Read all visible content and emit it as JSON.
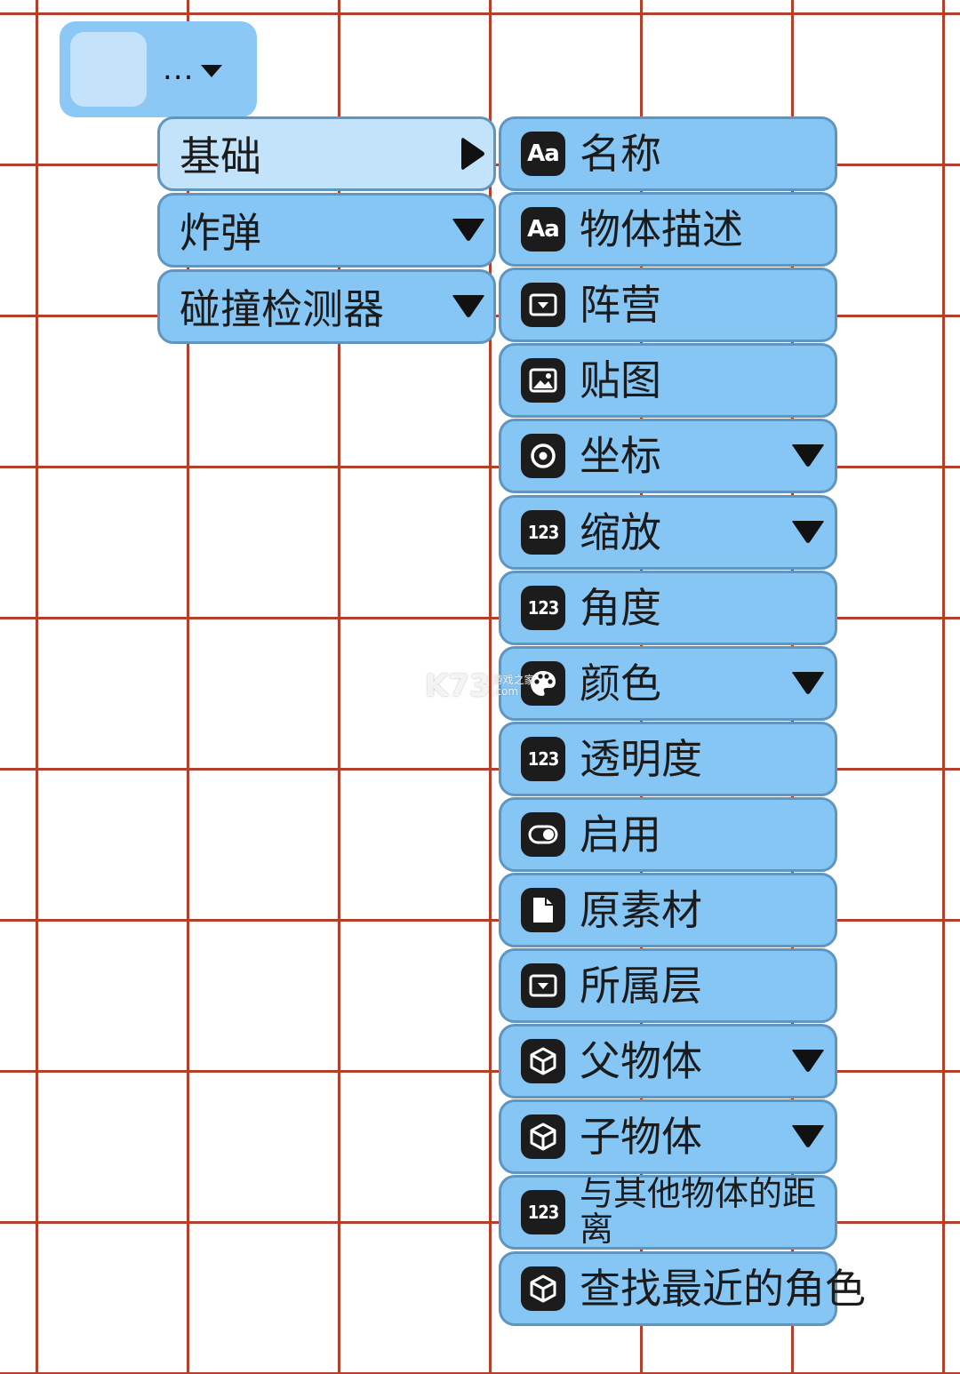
{
  "trigger": {
    "dots": "..."
  },
  "categories": [
    {
      "label": "基础",
      "arrow": "right",
      "selected": true
    },
    {
      "label": "炸弹",
      "arrow": "down",
      "selected": false
    },
    {
      "label": "碰撞检测器",
      "arrow": "down",
      "selected": false
    }
  ],
  "properties": [
    {
      "label": "名称",
      "icon": "text-icon",
      "icon_text": "Aa",
      "arrow": "none"
    },
    {
      "label": "物体描述",
      "icon": "text-icon",
      "icon_text": "Aa",
      "arrow": "none"
    },
    {
      "label": "阵营",
      "icon": "dropdown-box-icon",
      "arrow": "none"
    },
    {
      "label": "贴图",
      "icon": "image-icon",
      "arrow": "none"
    },
    {
      "label": "坐标",
      "icon": "target-icon",
      "arrow": "down"
    },
    {
      "label": "缩放",
      "icon": "number-icon",
      "icon_text": "123",
      "arrow": "down"
    },
    {
      "label": "角度",
      "icon": "number-icon",
      "icon_text": "123",
      "arrow": "none"
    },
    {
      "label": "颜色",
      "icon": "palette-icon",
      "arrow": "down"
    },
    {
      "label": "透明度",
      "icon": "number-icon",
      "icon_text": "123",
      "arrow": "none"
    },
    {
      "label": "启用",
      "icon": "toggle-icon",
      "arrow": "none"
    },
    {
      "label": "原素材",
      "icon": "file-icon",
      "arrow": "none"
    },
    {
      "label": "所属层",
      "icon": "dropdown-box-icon",
      "arrow": "none"
    },
    {
      "label": "父物体",
      "icon": "cube-icon",
      "arrow": "down"
    },
    {
      "label": "子物体",
      "icon": "cube-icon",
      "arrow": "down"
    },
    {
      "label": "与其他物体的距离",
      "icon": "number-icon",
      "icon_text": "123",
      "arrow": "none"
    },
    {
      "label": "查找最近的角色",
      "icon": "cube-icon",
      "arrow": "none"
    }
  ],
  "watermark": {
    "main": "K73",
    "sub1": "游戏之家",
    "sub2": ".com"
  }
}
